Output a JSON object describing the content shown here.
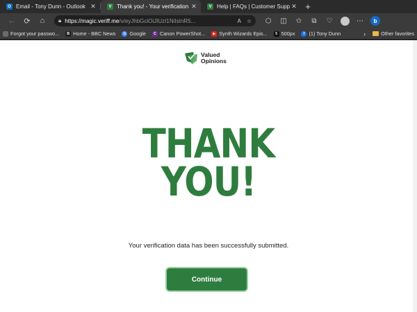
{
  "tabs": [
    {
      "title": "Email - Tony Dunn - Outlook",
      "favicon": "outlook-icon",
      "color": "#0f6cbd",
      "glyph": "O",
      "active": false
    },
    {
      "title": "Thank you! - Your verification da",
      "favicon": "veriff-icon",
      "color": "#2e7d3e",
      "glyph": "V",
      "active": true
    },
    {
      "title": "Help | FAQs | Customer Support",
      "favicon": "valued-opinions-icon",
      "color": "#2e7d3e",
      "glyph": "V",
      "active": false
    }
  ],
  "address": {
    "host": "https://magic.veriff.me",
    "path": "/v/eyJhbGciOiJIUzI1NiIsInR5..."
  },
  "bookmarks": [
    {
      "label": "Forgot your passwo...",
      "icon": "page-icon",
      "color": "#6b6b6b",
      "glyph": "■"
    },
    {
      "label": "Home - BBC News",
      "icon": "bbc-icon",
      "color": "#222222",
      "glyph": "B"
    },
    {
      "label": "Google",
      "icon": "google-icon",
      "color": "#4285f4",
      "glyph": "G"
    },
    {
      "label": "Canon PowerShot...",
      "icon": "canon-icon",
      "color": "#6a2c91",
      "glyph": "C"
    },
    {
      "label": "Synth Wizards Epis...",
      "icon": "youtube-icon",
      "color": "#e62117",
      "glyph": "▶"
    },
    {
      "label": "500px",
      "icon": "500px-icon",
      "color": "#111111",
      "glyph": "5"
    },
    {
      "label": "(1) Tony Dunn",
      "icon": "facebook-icon",
      "color": "#1877f2",
      "glyph": "f"
    }
  ],
  "bookmarks_folder": "Other favorites",
  "page": {
    "logo_line1": "Valued",
    "logo_line2": "Opinions",
    "heading_line1": "THANK",
    "heading_line2": "YOU!",
    "message": "Your verification data has been successfully submitted.",
    "continue_label": "Continue"
  },
  "colors": {
    "brand_green": "#2e7d3e",
    "button_border": "#9ad0a2"
  }
}
